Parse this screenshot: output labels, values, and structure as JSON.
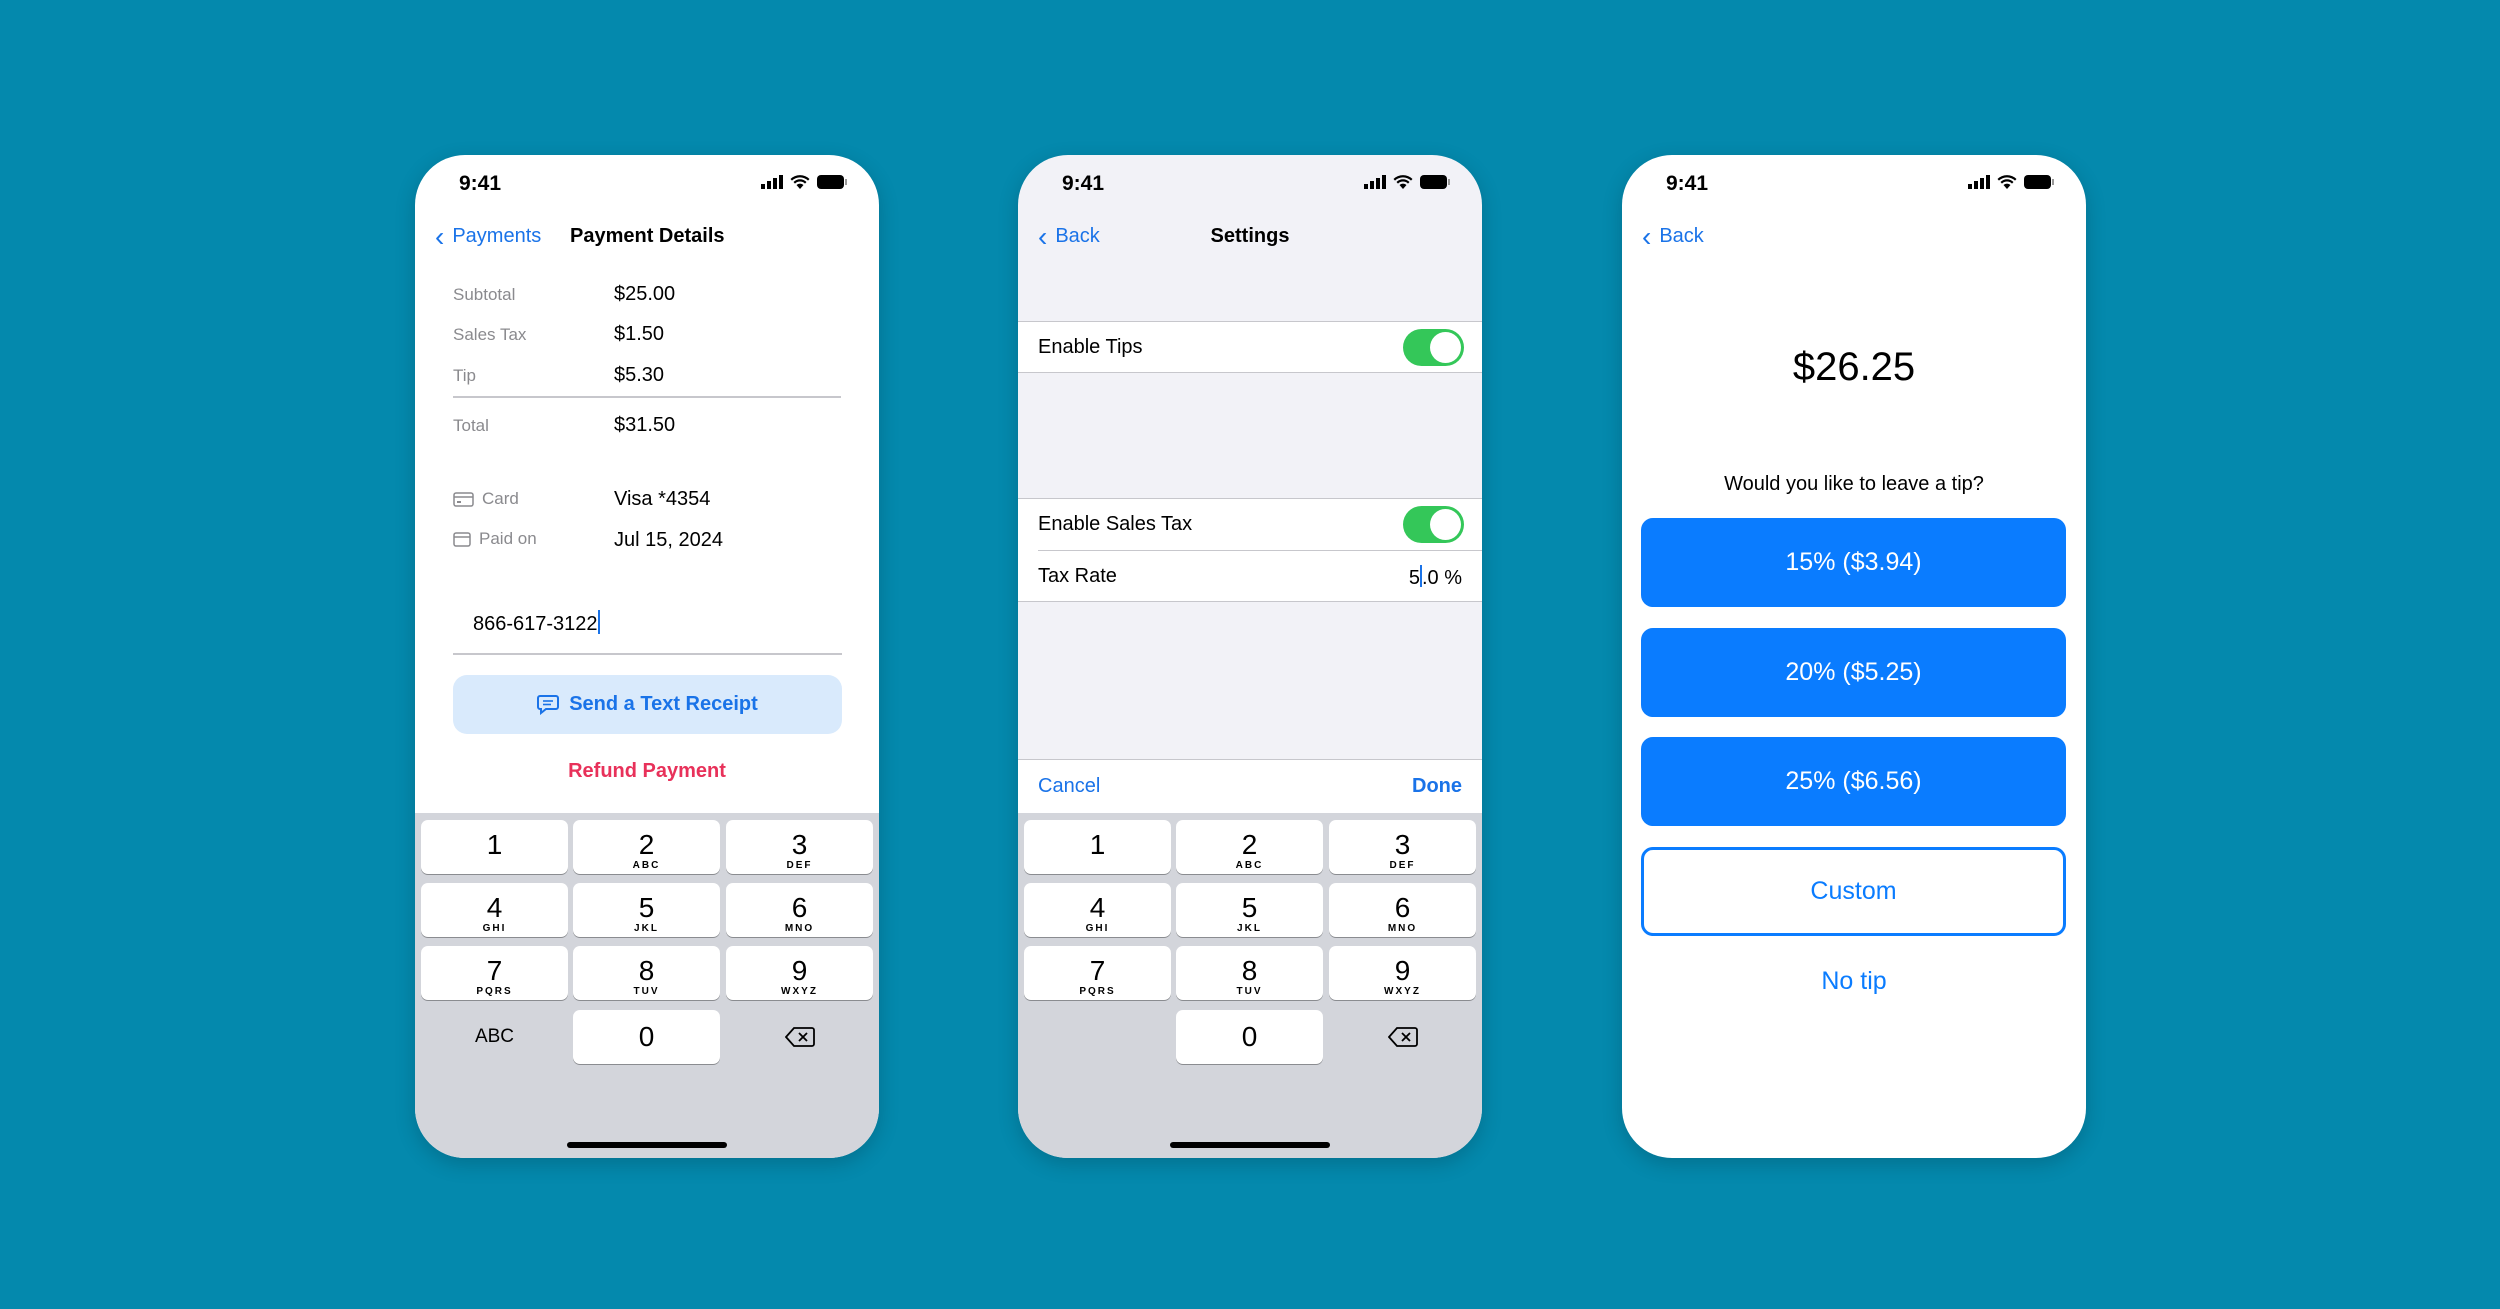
{
  "status": {
    "time": "9:41",
    "icons": [
      "cellular-signal-icon",
      "wifi-icon",
      "battery-icon"
    ]
  },
  "screen1": {
    "back": "Payments",
    "title": "Payment Details",
    "rows": [
      {
        "label": "Subtotal",
        "value": "$25.00"
      },
      {
        "label": "Sales Tax",
        "value": "$1.50"
      },
      {
        "label": "Tip",
        "value": "$5.30"
      },
      {
        "label": "Total",
        "value": "$31.50"
      }
    ],
    "card": {
      "label": "Card",
      "value": "Visa *4354",
      "icon": "credit-card-icon"
    },
    "paid": {
      "label": "Paid on",
      "value": "Jul 15, 2024",
      "icon": "calendar-icon"
    },
    "phone_input": "866-617-3122",
    "send_button": "Send a Text Receipt",
    "refund_button": "Refund Payment",
    "abc_key": "ABC"
  },
  "screen2": {
    "back": "Back",
    "title": "Settings",
    "enable_tips": "Enable Tips",
    "enable_tips_on": true,
    "enable_sales_tax": "Enable Sales Tax",
    "enable_sales_tax_on": true,
    "tax_rate_label": "Tax Rate",
    "tax_rate_int": "5",
    "tax_rate_rest": ".0 %",
    "cancel": "Cancel",
    "done": "Done"
  },
  "screen3": {
    "back": "Back",
    "amount": "$26.25",
    "question": "Would you like to leave a tip?",
    "options": [
      "15% ($3.94)",
      "20% ($5.25)",
      "25% ($6.56)"
    ],
    "custom": "Custom",
    "no_tip": "No tip"
  },
  "keypad": [
    [
      "1",
      ""
    ],
    [
      "2",
      "ABC"
    ],
    [
      "3",
      "DEF"
    ],
    [
      "4",
      "GHI"
    ],
    [
      "5",
      "JKL"
    ],
    [
      "6",
      "MNO"
    ],
    [
      "7",
      "PQRS"
    ],
    [
      "8",
      "TUV"
    ],
    [
      "9",
      "WXYZ"
    ],
    [
      "0",
      ""
    ]
  ],
  "colors": {
    "background": "#0489ad",
    "accent": "#1a73e8",
    "destructive": "#e8315a",
    "toggle": "#34c759",
    "tip_button": "#0a7cff"
  }
}
